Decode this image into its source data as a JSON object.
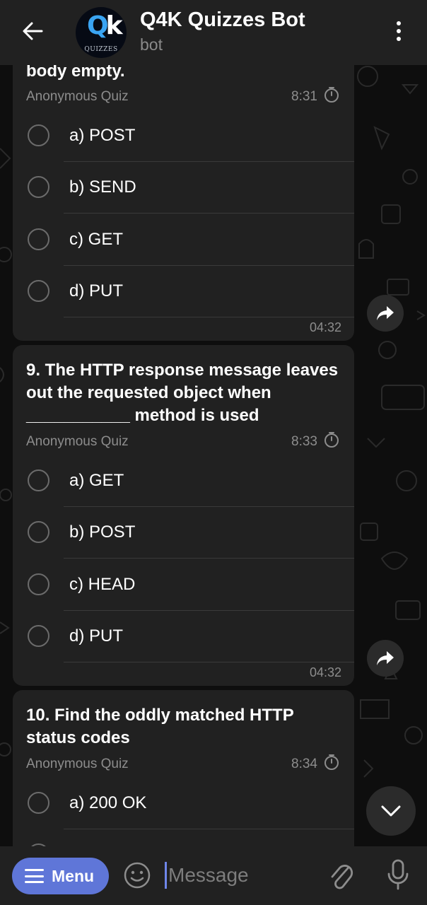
{
  "header": {
    "title": "Q4K Quizzes Bot",
    "subtitle": "bot",
    "avatar_text": "QUIZZES"
  },
  "messages": [
    {
      "question": "body empty.",
      "quiz_type": "Anonymous Quiz",
      "quiz_time": "8:31",
      "options": [
        "a) POST",
        "b) SEND",
        "c) GET",
        "d) PUT"
      ],
      "time": "04:32"
    },
    {
      "question": "9. The HTTP response message leaves out the requested object when ___________ method is used",
      "quiz_type": "Anonymous Quiz",
      "quiz_time": "8:33",
      "options": [
        "a) GET",
        "b) POST",
        "c) HEAD",
        "d) PUT"
      ],
      "time": "04:32"
    },
    {
      "question": "10. Find the oddly matched HTTP status codes",
      "quiz_type": "Anonymous Quiz",
      "quiz_time": "8:34",
      "options": [
        "a) 200 OK"
      ]
    }
  ],
  "input_bar": {
    "menu_label": "Menu",
    "placeholder": "Message"
  },
  "icons": {
    "back": "arrow-left-icon",
    "more": "more-vertical-icon",
    "timer": "timer-icon",
    "share": "share-arrow-icon",
    "scroll_down": "chevron-down-icon",
    "emoji": "smiley-icon",
    "attach": "paperclip-icon",
    "mic": "microphone-icon"
  },
  "colors": {
    "background": "#0e0e0e",
    "surface": "#212121",
    "accent": "#5f76d8",
    "muted_text": "#8d8d8d"
  }
}
